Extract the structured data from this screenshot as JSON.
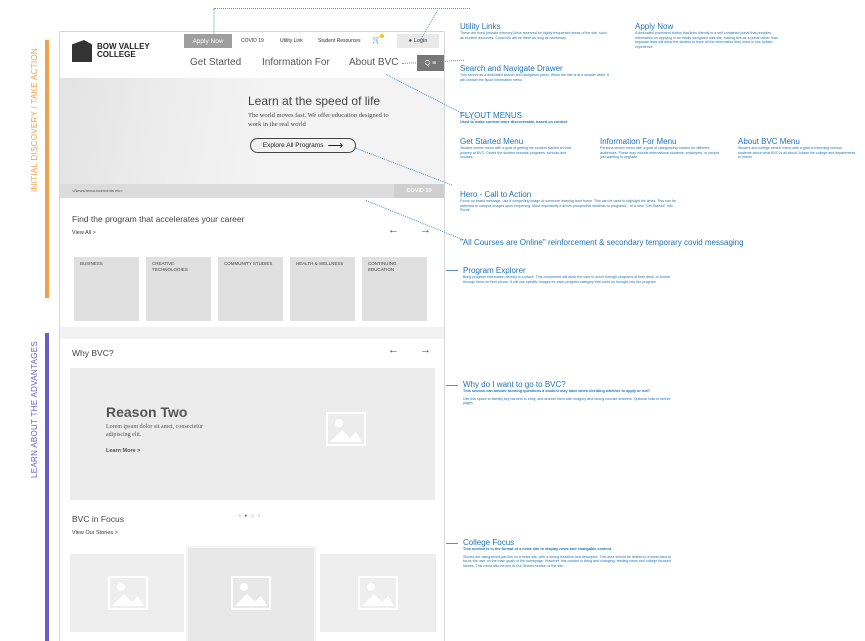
{
  "side_labels": {
    "orange": "INITIAL DISCOVERY / TAKE ACTION",
    "purple": "LEARN ABOUT THE ADVANTAGES"
  },
  "header": {
    "logo_line1": "BOW VALLEY",
    "logo_line2": "COLLEGE",
    "apply": "Apply Now",
    "utility": [
      "COVID 19",
      "Utility Link",
      "Student Resources"
    ],
    "login": "Login",
    "nav": [
      "Get Started",
      "Information For",
      "About BVC"
    ],
    "search_glyph": "Q ≡"
  },
  "hero": {
    "headline": "Learn at the speed of life",
    "body": "The world moves fast. We offer education designed to work in the real world",
    "cta": "Explore All Programs",
    "news": "<News/announcements etc>",
    "covid": "COVID 19"
  },
  "programs": {
    "title": "Find the program that accelerates your career",
    "link": "View All >",
    "tiles": [
      "BUSINESS",
      "CREATIVE TECHNOLOGIES",
      "COMMUNITY STUDIES",
      "HEALTH & WELLNESS",
      "CONTINUING EDUCATION"
    ]
  },
  "why": {
    "title": "Why BVC?",
    "reason_title": "Reason Two",
    "reason_body": "Lorem ipsum dolor sit amet, consectetur adipiscing elit.",
    "reason_link": "Learn More >",
    "dots": "○ ● ○ ○"
  },
  "focus": {
    "title": "BVC in Focus",
    "link": "View Our Stories >"
  },
  "annotations": {
    "utility": {
      "title": "Utility Links",
      "body": "These are fixed (muscle memory) links reserved for highly frequented areas of the site, such as student resources. Covid link will be there as long as necessary"
    },
    "apply": {
      "title": "Apply Now",
      "body": "A dedicated prominent button that links directly to a self contained portal that provides information on applying in an easily navigated mini site. Having this as a portal rather than separate links will allow the student to have all the information they need in one holistic experience"
    },
    "search": {
      "title": "Search and Navigate Drawer",
      "body": "This serves as a dedicated search and navigation panel. When the site is at a smaller width, it will contain the flyout information menu"
    },
    "flyout": {
      "title": "FLYOUT MENUS",
      "sub": "Used to make content more discoverable, based on context"
    },
    "get_started": {
      "title": "Get Started Menu",
      "body": "Student centric menu with a goal of getting the student started on their journey at BVC. Drives the student towards programs, schools and courses."
    },
    "info_for": {
      "title": "Information For Menu",
      "body": "Persona centric menu with a goal of categorizing content for different audiences. These may include international students, employers, or people just wanting to upgrade"
    },
    "about": {
      "title": "About BVC Menu",
      "body": "Student and college centric menu with a goal of informing curious students about what BVC is all about. Allows the college and departments to inform"
    },
    "hero_cta": {
      "title": "Hero - Call to Action",
      "body": "Focus on brand message, use a compelling image of someone learning from home. This can be used to highlight the times. This can be switched to campus images upon reopening. Most importantly it drives prospective students to programs... or a new \"Get Started\" Info Portal"
    },
    "online": {
      "title": "\"All Courses are Online\" reinforcement & secondary temporary covid messaging"
    },
    "explorer": {
      "title": "Program Explorer",
      "body": "Bring program information directly to surface. This component will allow the user to scroll through programs at their desk, or thumb through them on their phone. It will use specific images for each program category that could be brought into the program"
    },
    "why": {
      "title": "Why do I want to go to BVC?",
      "sub": "This section can answer burning questions a student may have when deciding whether to apply or not?",
      "body": "Use this space to identify key barriers to entry, and answer them with imagery and strong concise answers. Optional links to further pages"
    },
    "focus": {
      "title": "College Focus",
      "sub": "This section is in the format of a news site to display news and changable content",
      "body": "Stories are categorized just like on a news site, with a strong headline and descriptor. This area should be limited to a small area to focus the user on the main goals of the homepage. However, this content is living and changing, feeding news and college focused stories. This could also be link to Our Stories section of the site."
    }
  }
}
